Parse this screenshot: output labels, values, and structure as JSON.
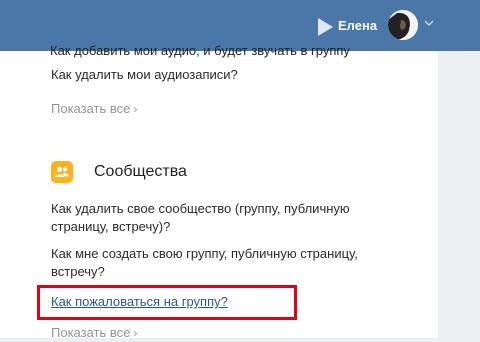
{
  "header": {
    "user_name": "Елена"
  },
  "help": {
    "music": {
      "cut_question": "Как добавить мои аудио, и будет звучать в группу",
      "question_delete": "Как удалить мои аудиозаписи?",
      "show_all": "Показать все"
    },
    "communities": {
      "title": "Сообщества",
      "questions": [
        "Как удалить свое сообщество (группу, публичную страницу, встречу)?",
        "Как мне создать свою группу, публичную страницу, встречу?",
        "Как пожаловаться на группу?"
      ],
      "show_all": "Показать все"
    }
  },
  "colors": {
    "header_bg": "#4a76a8",
    "community_icon": "#fdb21e",
    "highlight_box": "#e3001b",
    "link": "#2a5885"
  }
}
